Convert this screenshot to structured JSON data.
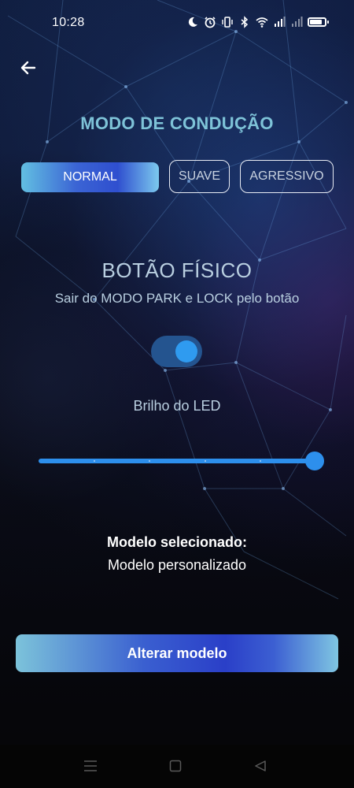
{
  "status_bar": {
    "time": "10:28",
    "icons": [
      "moon-icon",
      "alarm-icon",
      "vibrate-icon",
      "bluetooth-icon",
      "wifi-icon",
      "signal-icon",
      "signal-icon",
      "battery-icon"
    ],
    "battery_level": 0.85
  },
  "header": {
    "back_icon": "arrow-left-icon",
    "title": "MODO DE CONDUÇÃO"
  },
  "modes": {
    "options": [
      "NORMAL",
      "SUAVE",
      "AGRESSIVO"
    ],
    "selected": "NORMAL"
  },
  "physical_button": {
    "title": "BOTÃO FÍSICO",
    "subtitle": "Sair do MODO PARK e LOCK pelo botão",
    "toggle_on": true
  },
  "led": {
    "label": "Brilho do LED",
    "value": 1.0,
    "steps": 5
  },
  "model": {
    "label": "Modelo selecionado:",
    "value": "Modelo personalizado"
  },
  "actions": {
    "change_model_label": "Alterar modelo"
  },
  "nav_bar": {
    "icons": [
      "menu-icon",
      "home-icon",
      "back-icon"
    ]
  },
  "colors": {
    "title": "#7ec3d8",
    "accent": "#2d8fec",
    "toggle_track": "#24548f"
  }
}
